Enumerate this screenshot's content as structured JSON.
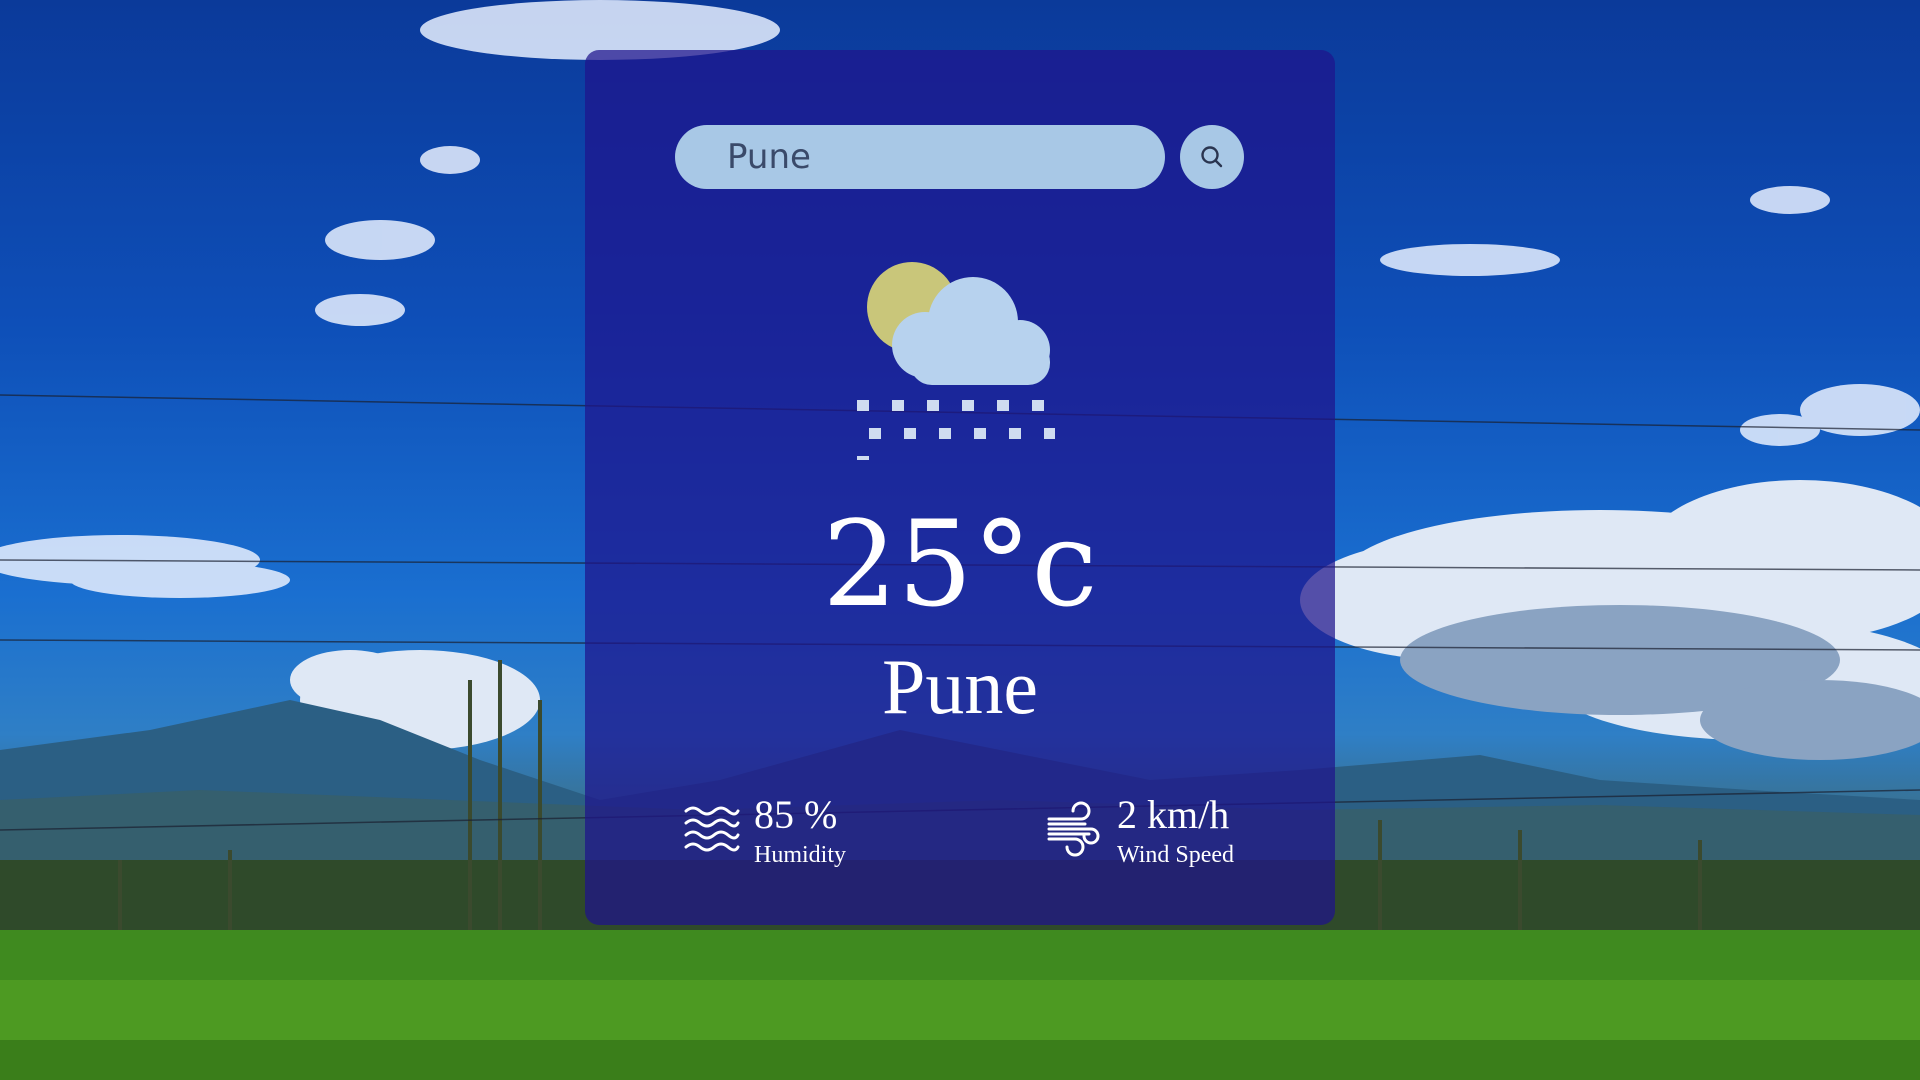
{
  "search": {
    "value": "Pune",
    "button_icon": "search-icon"
  },
  "weather": {
    "icon": "snow-cloud-sun-icon",
    "temperature": "25°c",
    "city": "Pune"
  },
  "stats": {
    "humidity": {
      "icon": "humidity-waves-icon",
      "value": "85 %",
      "label": "Humidity"
    },
    "wind": {
      "icon": "wind-icon",
      "value": "2 km/h",
      "label": "Wind Speed"
    }
  },
  "colors": {
    "card": "#1e148c",
    "search_bg": "#a8c8e6",
    "text": "#ffffff"
  }
}
